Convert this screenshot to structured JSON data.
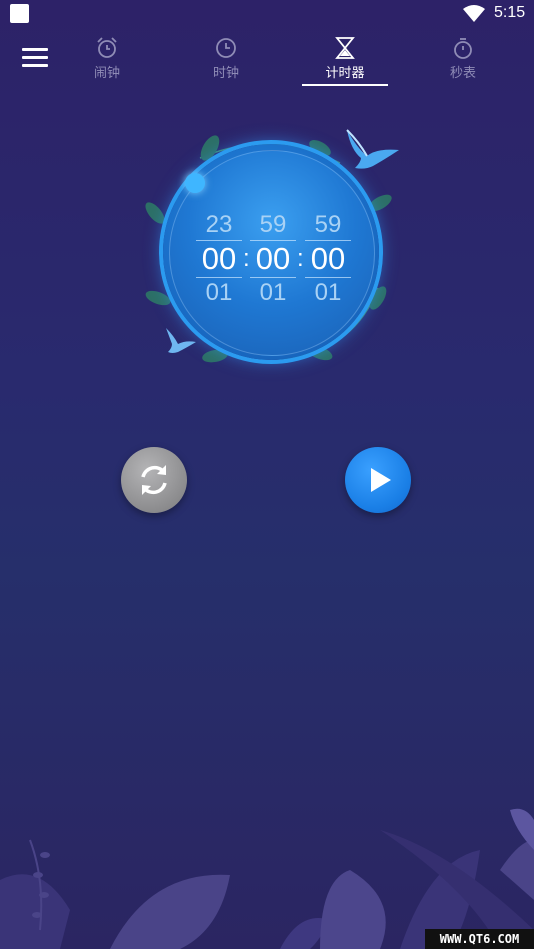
{
  "status_bar": {
    "time": "5:15"
  },
  "tabs": [
    {
      "label": "闹钟",
      "icon": "alarm-clock-icon",
      "active": false
    },
    {
      "label": "时钟",
      "icon": "clock-icon",
      "active": false
    },
    {
      "label": "计时器",
      "icon": "hourglass-icon",
      "active": true
    },
    {
      "label": "秒表",
      "icon": "stopwatch-icon",
      "active": false
    }
  ],
  "timer": {
    "hours": {
      "prev": "23",
      "current": "00",
      "next": "01"
    },
    "minutes": {
      "prev": "59",
      "current": "00",
      "next": "01"
    },
    "seconds": {
      "prev": "59",
      "current": "00",
      "next": "01"
    },
    "separator": ":"
  },
  "controls": {
    "reset_icon": "refresh-icon",
    "play_icon": "play-icon"
  },
  "colors": {
    "accent": "#1a7fe6",
    "background": "#2a2668",
    "reset_button": "#8c8c8e"
  },
  "watermark": "WWW.QT6.COM"
}
